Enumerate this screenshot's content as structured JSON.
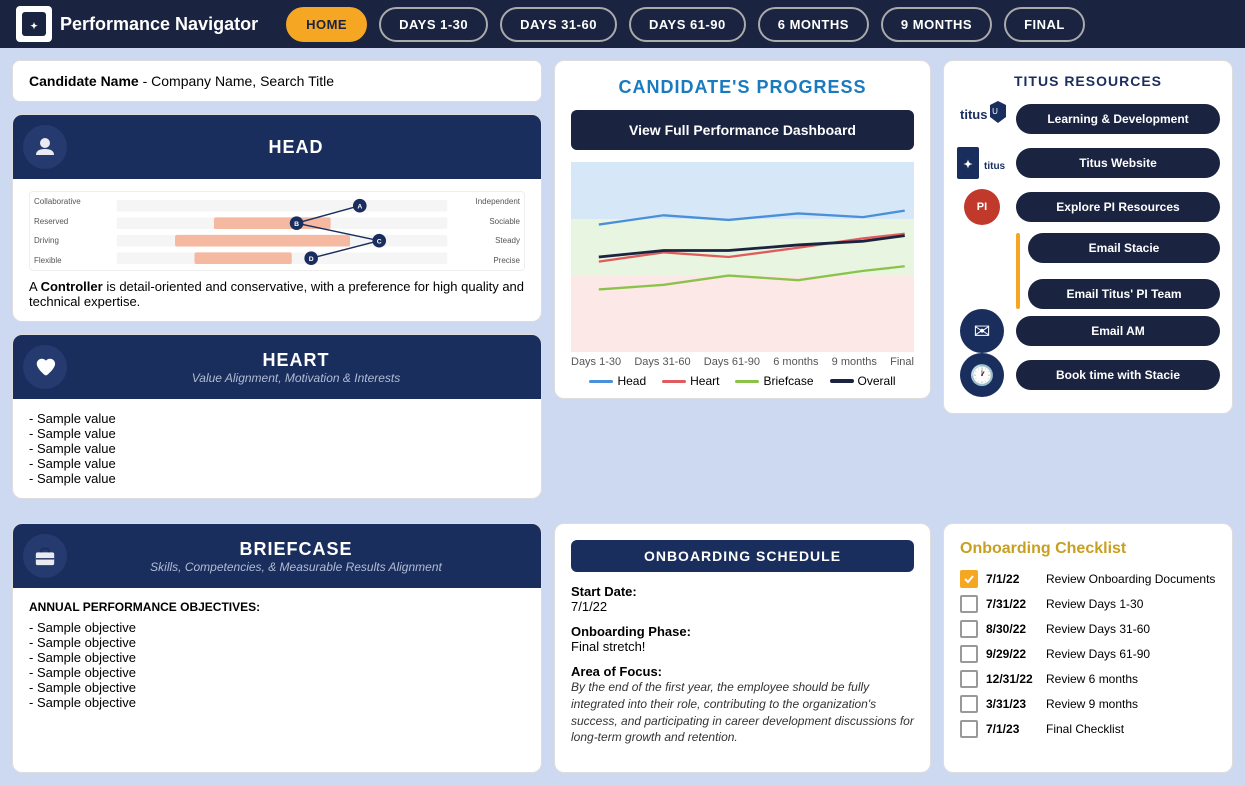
{
  "app": {
    "title": "Performance Navigator",
    "logo": "titus"
  },
  "nav": {
    "buttons": [
      "HOME",
      "DAYS 1-30",
      "DAYS 31-60",
      "DAYS 61-90",
      "6 MONTHS",
      "9 MONTHS",
      "FINAL"
    ],
    "active": "HOME"
  },
  "candidate": {
    "label": "Candidate Name",
    "info": " - Company Name, Search Title"
  },
  "head_section": {
    "title": "HEAD",
    "icon": "👤",
    "description": "A ",
    "type": "Controller",
    "type_desc": " is detail-oriented and conservative, with a preference for high quality and technical expertise.",
    "chart_left_labels": [
      "Collaborative",
      "Reserved",
      "Driving",
      "Flexible"
    ],
    "chart_right_labels": [
      "Independent",
      "Sociable",
      "Steady",
      "Precise"
    ]
  },
  "heart_section": {
    "title": "HEART",
    "subtitle": "Value Alignment, Motivation & Interests",
    "icon": "♥",
    "items": [
      "- Sample value",
      "- Sample value",
      "- Sample value",
      "- Sample value",
      "- Sample value"
    ]
  },
  "briefcase_section": {
    "title": "BRIEFCASE",
    "subtitle": "Skills, Competencies, & Measurable Results Alignment",
    "icon": "💼",
    "annual_label": "ANNUAL PERFORMANCE OBJECTIVES:",
    "items": [
      "- Sample objective",
      "- Sample objective",
      "- Sample objective",
      "- Sample objective",
      "- Sample objective",
      "- Sample objective"
    ]
  },
  "progress": {
    "title": "CANDIDATE'S PROGRESS",
    "dashboard_btn": "View Full Performance Dashboard",
    "x_labels": [
      "Days 1-30",
      "Days 31-60",
      "Days 61-90",
      "6 months",
      "9 months",
      "Final"
    ],
    "legend": [
      {
        "label": "Head",
        "color": "#4a90d9"
      },
      {
        "label": "Heart",
        "color": "#e05c5c"
      },
      {
        "label": "Briefcase",
        "color": "#8bc34a"
      },
      {
        "label": "Overall",
        "color": "#1a2340"
      }
    ]
  },
  "onboarding_schedule": {
    "title": "ONBOARDING SCHEDULE",
    "start_date_label": "Start Date:",
    "start_date": "7/1/22",
    "phase_label": "Onboarding Phase:",
    "phase": "Final stretch!",
    "focus_label": "Area of Focus:",
    "focus_text": "By the end of the first year, the employee should be fully integrated into their role, contributing to the organization's success, and participating in career development discussions for long-term growth and retention."
  },
  "resources": {
    "title": "TITUS RESOURCES",
    "items": [
      {
        "logo_type": "titus_shield",
        "btn_label": "Learning & Development"
      },
      {
        "logo_type": "titus_wordmark",
        "btn_label": "Titus Website"
      },
      {
        "logo_type": "pi_logo",
        "btn_label": "Explore PI Resources"
      },
      {
        "logo_type": "none",
        "btn_label": "Email Stacie"
      },
      {
        "logo_type": "email_icon",
        "btn_label": "Email AM"
      },
      {
        "logo_type": "none",
        "btn_label": "Email Titus' PI Team"
      },
      {
        "logo_type": "clock_icon",
        "btn_label": "Book time with Stacie"
      }
    ]
  },
  "checklist": {
    "title": "Onboarding Checklist",
    "items": [
      {
        "date": "7/1/22",
        "label": "Review Onboarding Documents",
        "checked": true
      },
      {
        "date": "7/31/22",
        "label": "Review Days 1-30",
        "checked": false
      },
      {
        "date": "8/30/22",
        "label": "Review Days 31-60",
        "checked": false
      },
      {
        "date": "9/29/22",
        "label": "Review Days 61-90",
        "checked": false
      },
      {
        "date": "12/31/22",
        "label": "Review 6 months",
        "checked": false
      },
      {
        "date": "3/31/23",
        "label": "Review 9 months",
        "checked": false
      },
      {
        "date": "7/1/23",
        "label": "Final Checklist",
        "checked": false
      }
    ]
  }
}
